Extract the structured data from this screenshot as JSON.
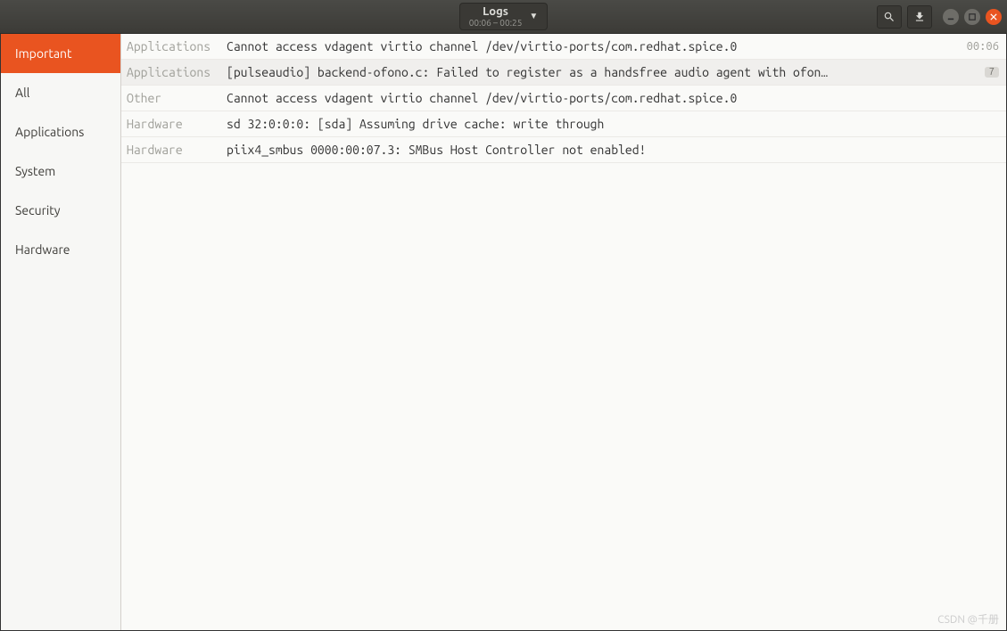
{
  "titlebar": {
    "title": "Logs",
    "subtitle": "00:06 – 00:25"
  },
  "sidebar": {
    "items": [
      {
        "label": "Important",
        "active": true
      },
      {
        "label": "All",
        "active": false
      },
      {
        "label": "Applications",
        "active": false
      },
      {
        "label": "System",
        "active": false
      },
      {
        "label": "Security",
        "active": false
      },
      {
        "label": "Hardware",
        "active": false
      }
    ]
  },
  "logs": [
    {
      "category": "Applications",
      "message": "Cannot access vdagent virtio channel /dev/virtio-ports/com.redhat.spice.0",
      "time": "00:06",
      "badge": ""
    },
    {
      "category": "Applications",
      "message": "[pulseaudio] backend-ofono.c: Failed to register as a handsfree audio agent with ofon…",
      "time": "",
      "badge": "7"
    },
    {
      "category": "Other",
      "message": "Cannot access vdagent virtio channel /dev/virtio-ports/com.redhat.spice.0",
      "time": "",
      "badge": ""
    },
    {
      "category": "Hardware",
      "message": "sd 32:0:0:0: [sda] Assuming drive cache: write through",
      "time": "",
      "badge": ""
    },
    {
      "category": "Hardware",
      "message": "piix4_smbus 0000:00:07.3: SMBus Host Controller not enabled!",
      "time": "",
      "badge": ""
    }
  ],
  "watermark": "CSDN @千册"
}
